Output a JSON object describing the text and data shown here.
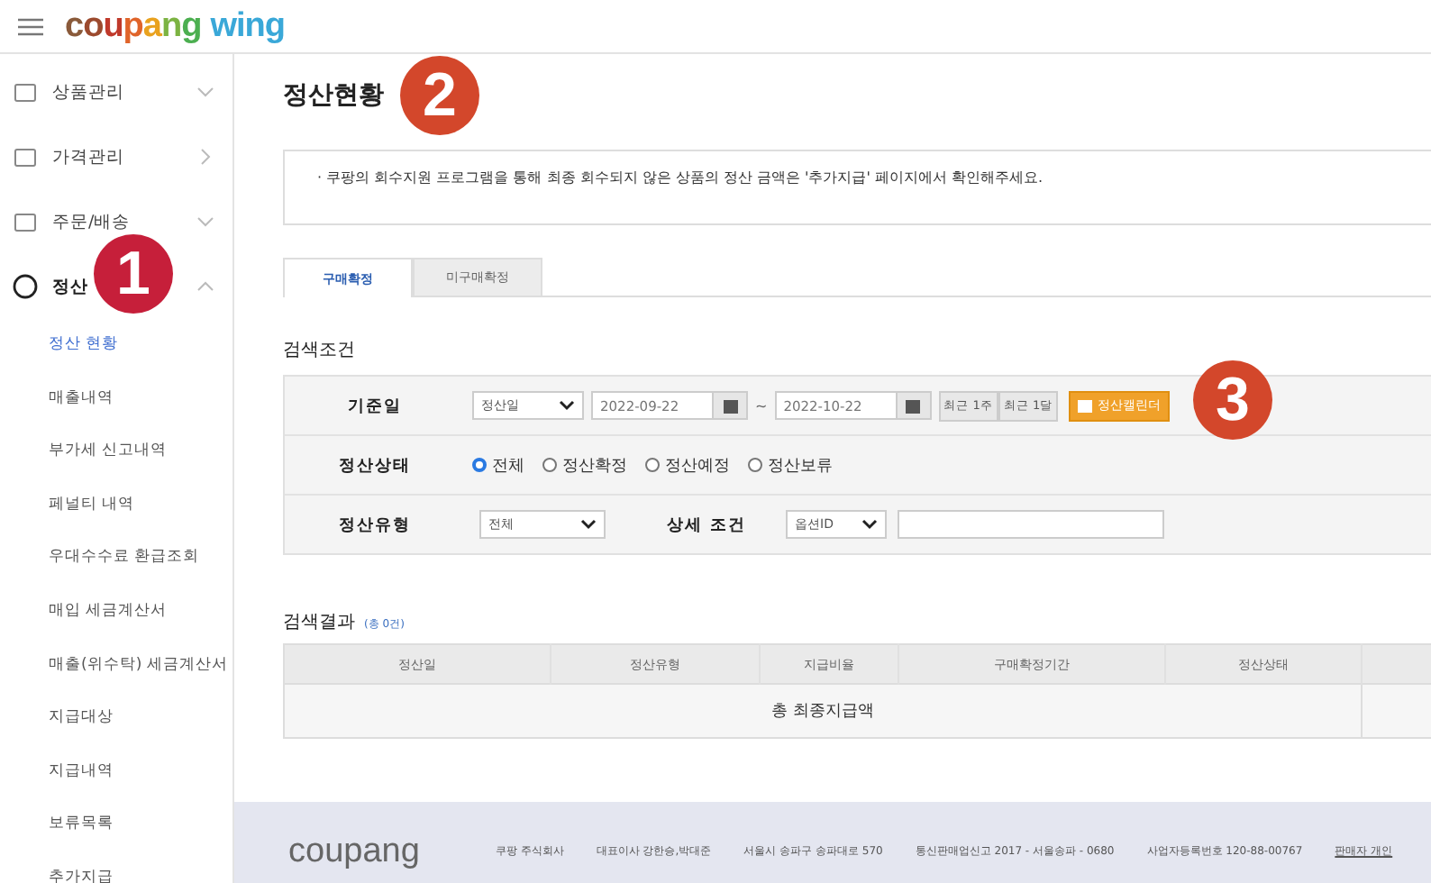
{
  "header": {
    "logo": "coupang",
    "logo_sub": "wing"
  },
  "sidebar": {
    "items": [
      {
        "label": "상품관리",
        "kind": "group",
        "expanded": false
      },
      {
        "label": "가격관리",
        "kind": "link",
        "expanded": false
      },
      {
        "label": "주문/배송",
        "kind": "group",
        "expanded": false
      },
      {
        "label": "정산",
        "kind": "group",
        "expanded": true,
        "children": [
          {
            "label": "정산 현황",
            "selected": true
          },
          {
            "label": "매출내역",
            "selected": false
          },
          {
            "label": "부가세 신고내역",
            "selected": false
          },
          {
            "label": "페널티 내역",
            "selected": false
          },
          {
            "label": "우대수수료 환급조회",
            "selected": false
          },
          {
            "label": "매입 세금계산서",
            "selected": false
          },
          {
            "label": "매출(위수탁) 세금계산서",
            "selected": false
          },
          {
            "label": "지급대상",
            "selected": false
          },
          {
            "label": "지급내역",
            "selected": false
          },
          {
            "label": "보류목록",
            "selected": false
          },
          {
            "label": "추가지급",
            "selected": false
          }
        ]
      }
    ]
  },
  "page": {
    "title": "정산현황",
    "notice": "· 쿠팡의 회수지원 프로그램을 통해 최종 회수되지 않은 상품의 정산 금액은 '추가지급' 페이지에서 확인해주세요."
  },
  "tabs": [
    {
      "label": "구매확정",
      "selected": true
    },
    {
      "label": "미구매확정",
      "selected": false
    }
  ],
  "search": {
    "title": "검색조건",
    "date_row": {
      "label": "기준일",
      "select": "정산일",
      "from": "2022-09-22",
      "separator": "~",
      "to": "2022-10-22",
      "buttons": [
        "최근 1주",
        "최근 1달"
      ],
      "calendar_button": "정산캘린더"
    },
    "status_row": {
      "label": "정산상태",
      "options": [
        {
          "label": "전체",
          "selected": true
        },
        {
          "label": "정산확정",
          "selected": false
        },
        {
          "label": "정산예정",
          "selected": false
        },
        {
          "label": "정산보류",
          "selected": false
        }
      ]
    },
    "type_row": {
      "label": "정산유형",
      "select": "전체",
      "detail_label": "상세 조건",
      "detail_select": "옵션ID"
    }
  },
  "results": {
    "title": "검색결과",
    "count": "(총 0건)",
    "table": {
      "columns": [
        "정산일",
        "정산유형",
        "지급비율",
        "구매확정기간",
        "정산상태"
      ],
      "total_label": "총 최종지급액"
    }
  },
  "footer": {
    "logo": "coupang",
    "items": [
      "쿠팡 주식회사",
      "대표이사 강한승,박대준",
      "서울시 송파구 송파대로 570",
      "통신판매업신고 2017 - 서울송파 - 0680",
      "사업자등록번호 120-88-00767"
    ],
    "link": "판매자 개인"
  },
  "annotations": [
    {
      "label": "1",
      "color": "#c61f3a"
    },
    {
      "label": "2",
      "color": "#d3472b"
    },
    {
      "label": "3",
      "color": "#d3472b"
    }
  ]
}
